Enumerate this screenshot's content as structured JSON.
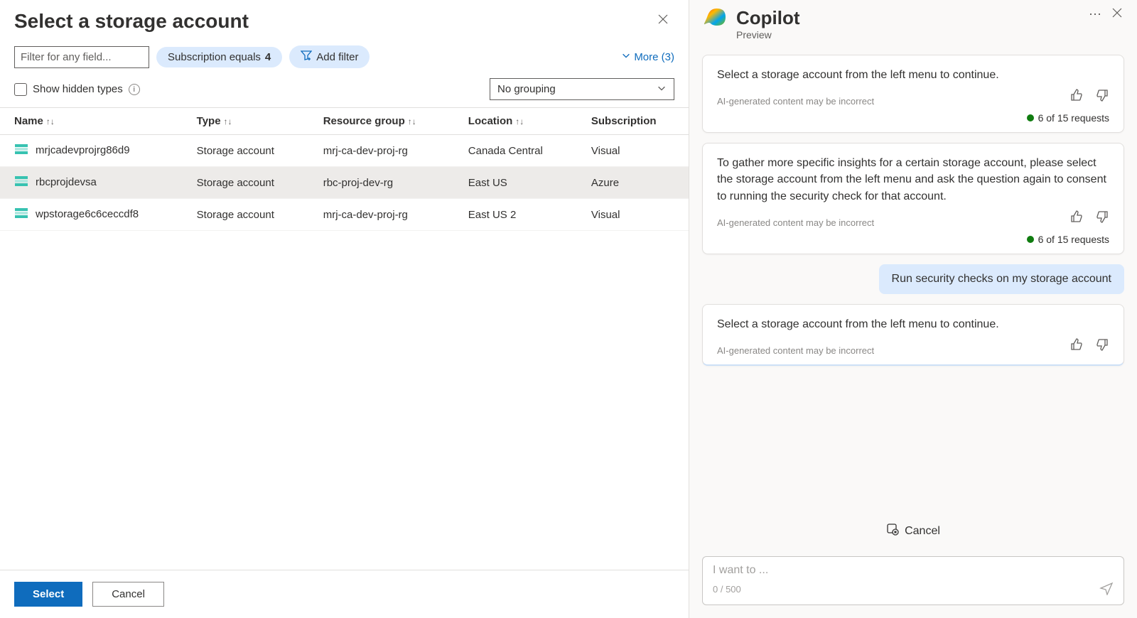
{
  "left": {
    "title": "Select a storage account",
    "filter_placeholder": "Filter for any field...",
    "subscription_pill_prefix": "Subscription equals ",
    "subscription_pill_value": "4",
    "add_filter_label": "Add filter",
    "more_label": "More (3)",
    "show_hidden_label": "Show hidden types",
    "grouping_selected": "No grouping",
    "columns": {
      "name": "Name",
      "type": "Type",
      "resource_group": "Resource group",
      "location": "Location",
      "subscription": "Subscription"
    },
    "rows": [
      {
        "name": "mrjcadevprojrg86d9",
        "type": "Storage account",
        "rg": "mrj-ca-dev-proj-rg",
        "location": "Canada Central",
        "subscription": "Visual",
        "selected": false
      },
      {
        "name": "rbcprojdevsa",
        "type": "Storage account",
        "rg": "rbc-proj-dev-rg",
        "location": "East US",
        "subscription": "Azure",
        "selected": true
      },
      {
        "name": "wpstorage6c6ceccdf8",
        "type": "Storage account",
        "rg": "mrj-ca-dev-proj-rg",
        "location": "East US 2",
        "subscription": "Visual",
        "selected": false
      }
    ],
    "footer": {
      "select": "Select",
      "cancel": "Cancel"
    }
  },
  "copilot": {
    "title": "Copilot",
    "subtitle": "Preview",
    "disclaimer": "AI-generated content may be incorrect",
    "requests_label": "6 of 15 requests",
    "messages": [
      {
        "role": "assistant",
        "text": "Select a storage account from the left menu to continue.",
        "show_requests": true
      },
      {
        "role": "assistant",
        "text": "To gather more specific insights for a certain storage account, please select the storage account from the left menu and ask the question again to consent to running the security check for that account.",
        "show_requests": true
      },
      {
        "role": "user",
        "text": "Run security checks on my storage account"
      },
      {
        "role": "assistant",
        "text": "Select a storage account from the left menu to continue.",
        "show_requests": false,
        "progress": true
      }
    ],
    "cancel_label": "Cancel",
    "input_placeholder": "I want to ...",
    "char_count": "0 / 500"
  }
}
